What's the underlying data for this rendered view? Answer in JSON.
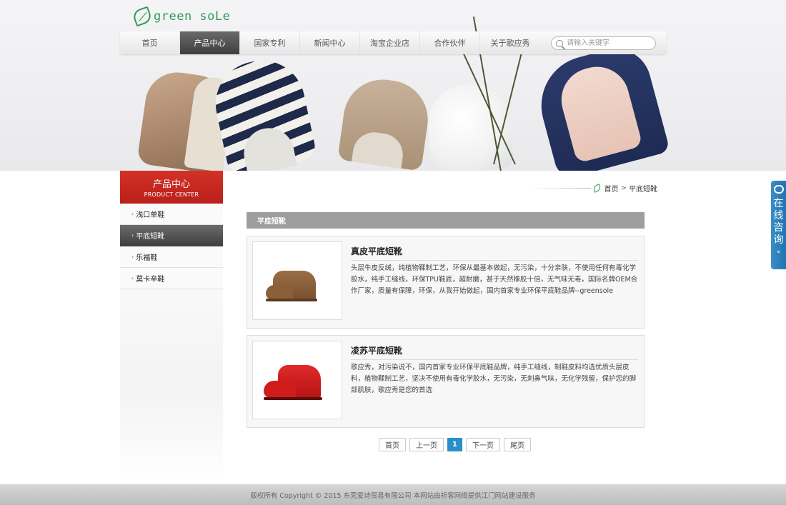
{
  "logo": {
    "text": "green soLe"
  },
  "nav": {
    "items": [
      {
        "label": "首页",
        "active": false
      },
      {
        "label": "产品中心",
        "active": true
      },
      {
        "label": "国家专利",
        "active": false
      },
      {
        "label": "新闻中心",
        "active": false
      },
      {
        "label": "淘宝企业店",
        "active": false
      },
      {
        "label": "合作伙伴",
        "active": false
      },
      {
        "label": "关于歌应秀",
        "active": false
      }
    ]
  },
  "search": {
    "placeholder": "请输入关键字",
    "value": ""
  },
  "sidebar": {
    "title": "产品中心",
    "subtitle": "PRODUCT CENTER",
    "items": [
      {
        "label": "浅口单鞋",
        "active": false
      },
      {
        "label": "平底短靴",
        "active": true
      },
      {
        "label": "乐福鞋",
        "active": false
      },
      {
        "label": "莫卡辛鞋",
        "active": false
      }
    ]
  },
  "breadcrumb": {
    "home": "首页",
    "separator": ">",
    "current": "平底短靴"
  },
  "section": {
    "title": "平底短靴"
  },
  "products": [
    {
      "title": "真皮平底短靴",
      "description": "头层牛皮反绒，纯植物鞣制工艺，环保从最基本做起，无污染，十分亲肤，不使用任何有毒化学胶水，纯手工缝线，环保TPU鞋底，超耐磨，甚于天然橡胶十倍，无气味无毒，国际名牌OEM合作厂家，质量有保障，环保，从我开始做起，国内首家专业环保平底鞋品牌--greensole",
      "shoe_color": "#8b5f3a"
    },
    {
      "title": "凌苏平底短靴",
      "description": "歌应秀，对污染说不，国内首家专业环保平底鞋品牌，纯手工缝线，制鞋皮料均选优质头层皮料，植物鞣制工艺，坚决不使用有毒化学胶水，无污染，无刺鼻气味，无化学残留，保护您的脚部肌肤，歌应秀是您的首选",
      "shoe_color": "#d11c1c"
    }
  ],
  "pagination": {
    "first": "首页",
    "prev": "上一页",
    "current": "1",
    "next": "下一页",
    "last": "尾页"
  },
  "footer": {
    "text": "版权所有 Copyright © 2015 东莞爱诗贸易有限公司   本网站由祈客网络提供江门网站建设服务"
  },
  "float_consult": {
    "label": "在线咨询",
    "collapse": "«"
  },
  "colors": {
    "brand_green": "#2e9a55",
    "sidebar_red": "#d43127",
    "active_dark": "#4a4a4a",
    "page_current": "#2a8fc9",
    "consult_blue": "#2a80bd"
  }
}
